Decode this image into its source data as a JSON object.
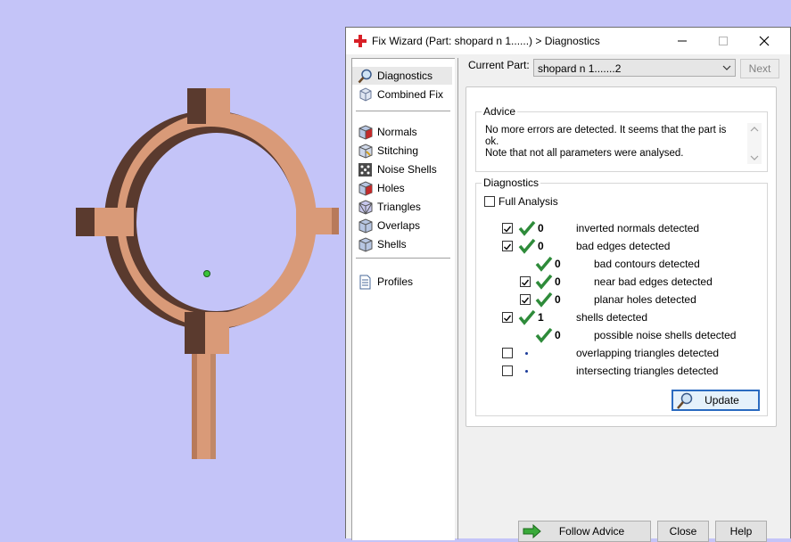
{
  "window": {
    "title": "Fix Wizard (Part: shopard n 1......) > Diagnostics"
  },
  "nav": {
    "items": [
      {
        "label": "Diagnostics",
        "icon": "magnifier-icon"
      },
      {
        "label": "Combined Fix",
        "icon": "combined-fix-icon"
      },
      {
        "label": "Normals",
        "icon": "normals-cube-icon"
      },
      {
        "label": "Stitching",
        "icon": "stitching-cube-icon"
      },
      {
        "label": "Noise Shells",
        "icon": "noise-shells-icon"
      },
      {
        "label": "Holes",
        "icon": "holes-cube-icon"
      },
      {
        "label": "Triangles",
        "icon": "triangles-cube-icon"
      },
      {
        "label": "Overlaps",
        "icon": "overlaps-cube-icon"
      },
      {
        "label": "Shells",
        "icon": "shells-cube-icon"
      },
      {
        "label": "Profiles",
        "icon": "profiles-document-icon"
      }
    ],
    "selected": "Diagnostics"
  },
  "part": {
    "label": "Current Part:",
    "value": "shopard n 1.......2",
    "next_label": "Next"
  },
  "advice": {
    "title": "Advice",
    "line1": "No more errors are detected. It seems that the part is ok.",
    "line2": "Note that not all parameters were analysed."
  },
  "diagnostics": {
    "title": "Diagnostics",
    "full_analysis_label": "Full Analysis",
    "full_analysis_checked": false,
    "rows": {
      "inverted_normals": {
        "count": "0",
        "label": "inverted normals detected",
        "checked": true
      },
      "bad_edges": {
        "count": "0",
        "label": "bad edges detected",
        "checked": true
      },
      "bad_contours": {
        "count": "0",
        "label": "bad contours detected"
      },
      "near_bad_edges": {
        "count": "0",
        "label": "near bad edges detected",
        "checked": true
      },
      "planar_holes": {
        "count": "0",
        "label": "planar holes detected",
        "checked": true
      },
      "shells": {
        "count": "1",
        "label": "shells detected",
        "checked": true
      },
      "noise_shells": {
        "count": "0",
        "label": "possible noise shells detected"
      },
      "overlapping_triangles": {
        "label": "overlapping triangles detected",
        "checked": false
      },
      "intersecting_triangles": {
        "label": "intersecting triangles detected",
        "checked": false
      }
    },
    "update_label": "Update"
  },
  "footer": {
    "follow_advice_label": "Follow Advice",
    "close_label": "Close",
    "help_label": "Help"
  },
  "colors": {
    "background": "#c4c4f8",
    "part_copper": "#d99a78",
    "part_dark": "#5a3a2e",
    "check_green": "#2e8b3a",
    "title_red": "#d81f26"
  }
}
